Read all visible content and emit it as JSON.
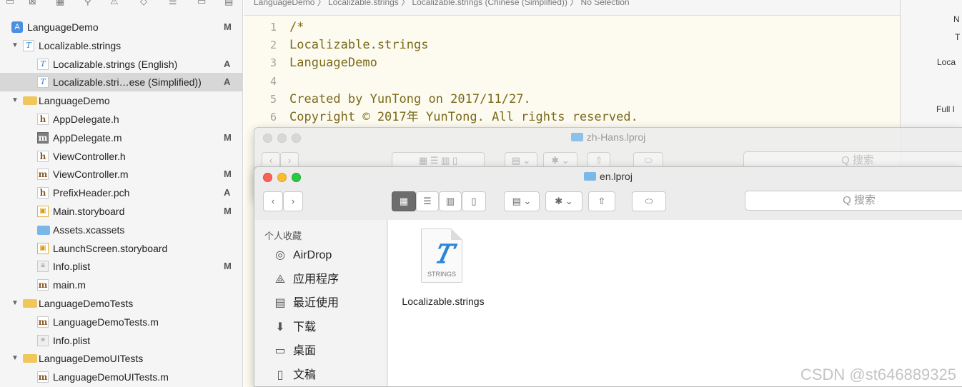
{
  "navigator": {
    "items": [
      {
        "label": "LanguageDemo",
        "badge": "M",
        "icon": "project-icon"
      },
      {
        "label": "Localizable.strings",
        "badge": "",
        "icon": "strings-icon"
      },
      {
        "label": "Localizable.strings (English)",
        "badge": "A",
        "icon": "strings-icon"
      },
      {
        "label": "Localizable.stri…ese (Simplified))",
        "badge": "A",
        "icon": "strings-icon"
      },
      {
        "label": "LanguageDemo",
        "badge": "",
        "icon": "folder-icon"
      },
      {
        "label": "AppDelegate.h",
        "badge": "",
        "icon": "header-file-icon"
      },
      {
        "label": "AppDelegate.m",
        "badge": "M",
        "icon": "source-file-icon"
      },
      {
        "label": "ViewController.h",
        "badge": "",
        "icon": "header-file-icon"
      },
      {
        "label": "ViewController.m",
        "badge": "M",
        "icon": "source-file-icon"
      },
      {
        "label": "PrefixHeader.pch",
        "badge": "A",
        "icon": "header-file-icon"
      },
      {
        "label": "Main.storyboard",
        "badge": "M",
        "icon": "storyboard-icon"
      },
      {
        "label": "Assets.xcassets",
        "badge": "",
        "icon": "assets-icon"
      },
      {
        "label": "LaunchScreen.storyboard",
        "badge": "",
        "icon": "storyboard-icon"
      },
      {
        "label": "Info.plist",
        "badge": "M",
        "icon": "plist-icon"
      },
      {
        "label": "main.m",
        "badge": "",
        "icon": "source-file-icon"
      },
      {
        "label": "LanguageDemoTests",
        "badge": "",
        "icon": "folder-icon"
      },
      {
        "label": "LanguageDemoTests.m",
        "badge": "",
        "icon": "source-file-icon"
      },
      {
        "label": "Info.plist",
        "badge": "",
        "icon": "plist-icon"
      },
      {
        "label": "LanguageDemoUITests",
        "badge": "",
        "icon": "folder-icon"
      },
      {
        "label": "LanguageDemoUITests.m",
        "badge": "",
        "icon": "source-file-icon"
      }
    ]
  },
  "editor": {
    "jumpbar": "LanguageDemo  〉  Localizable.strings  〉  Localizable.strings (Chinese (Simplified))  〉  No Selection",
    "lines": [
      {
        "n": "1",
        "text": "/*"
      },
      {
        "n": "2",
        "text": "  Localizable.strings"
      },
      {
        "n": "3",
        "text": "  LanguageDemo"
      },
      {
        "n": "4",
        "text": ""
      },
      {
        "n": "5",
        "text": "  Created by YunTong on 2017/11/27."
      },
      {
        "n": "6",
        "text": "  Copyright © 2017年 YunTong. All rights reserved."
      }
    ]
  },
  "inspector": {
    "labels": [
      "N",
      "T",
      "Loca",
      "Full I"
    ]
  },
  "finder_back": {
    "title": "zh-Hans.lproj",
    "search_placeholder": "Q 搜索"
  },
  "finder_front": {
    "title": "en.lproj",
    "search_placeholder": "Q 搜索",
    "sidebar_heading": "个人收藏",
    "sidebar_items": [
      {
        "label": "AirDrop",
        "icon": "airdrop-icon"
      },
      {
        "label": "应用程序",
        "icon": "applications-icon"
      },
      {
        "label": "最近使用",
        "icon": "recents-icon"
      },
      {
        "label": "下载",
        "icon": "downloads-icon"
      },
      {
        "label": "桌面",
        "icon": "desktop-icon"
      },
      {
        "label": "文稿",
        "icon": "documents-icon"
      }
    ],
    "file": {
      "name": "Localizable.strings",
      "type_label": "STRINGS"
    }
  },
  "watermark": "CSDN @st646889325",
  "colors": {
    "editor_bg": "#fdfbf0",
    "code_text": "#7a6a1b",
    "selection": "#d7d7d7",
    "folder": "#f1c75b"
  }
}
